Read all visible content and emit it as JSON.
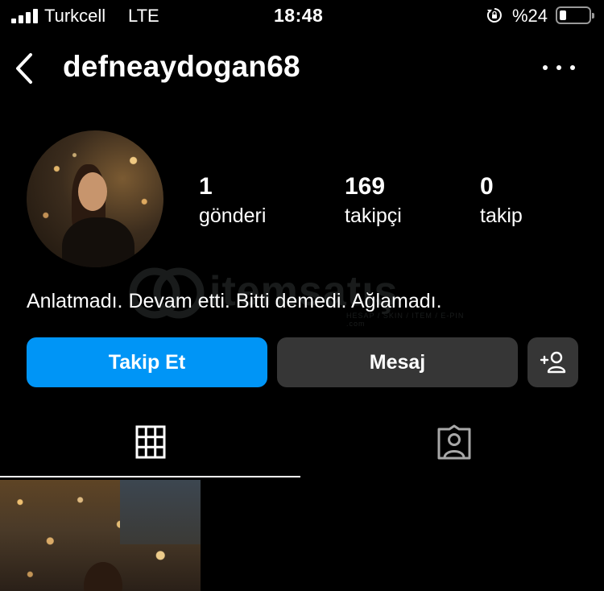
{
  "status_bar": {
    "carrier": "Turkcell",
    "network": "LTE",
    "time": "18:48",
    "battery_percent": "%24",
    "battery_level": 0.24,
    "icons": [
      "signal-icon",
      "orientation-lock-icon",
      "battery-icon"
    ]
  },
  "header": {
    "username": "defneaydogan68",
    "icons": [
      "back-chevron-icon",
      "more-options-icon"
    ]
  },
  "profile": {
    "stats": [
      {
        "value": "1",
        "label": "gönderi"
      },
      {
        "value": "169",
        "label": "takipçi"
      },
      {
        "value": "0",
        "label": "takip"
      }
    ],
    "bio": "Anlatmadı. Devam etti. Bitti demedi. Ağlamadı."
  },
  "actions": {
    "follow_label": "Takip Et",
    "message_label": "Mesaj",
    "suggest_icon": "add-person-icon"
  },
  "tabs": [
    {
      "icon": "grid-icon",
      "active": true
    },
    {
      "icon": "tagged-person-icon",
      "active": false
    }
  ],
  "watermark": {
    "text": "itemsatış",
    "subtext": "HESAP / SKIN / ITEM / E-PIN .com"
  },
  "colors": {
    "background": "#000000",
    "primary_button": "#0095f6",
    "secondary_button": "#363636",
    "text": "#ffffff"
  }
}
